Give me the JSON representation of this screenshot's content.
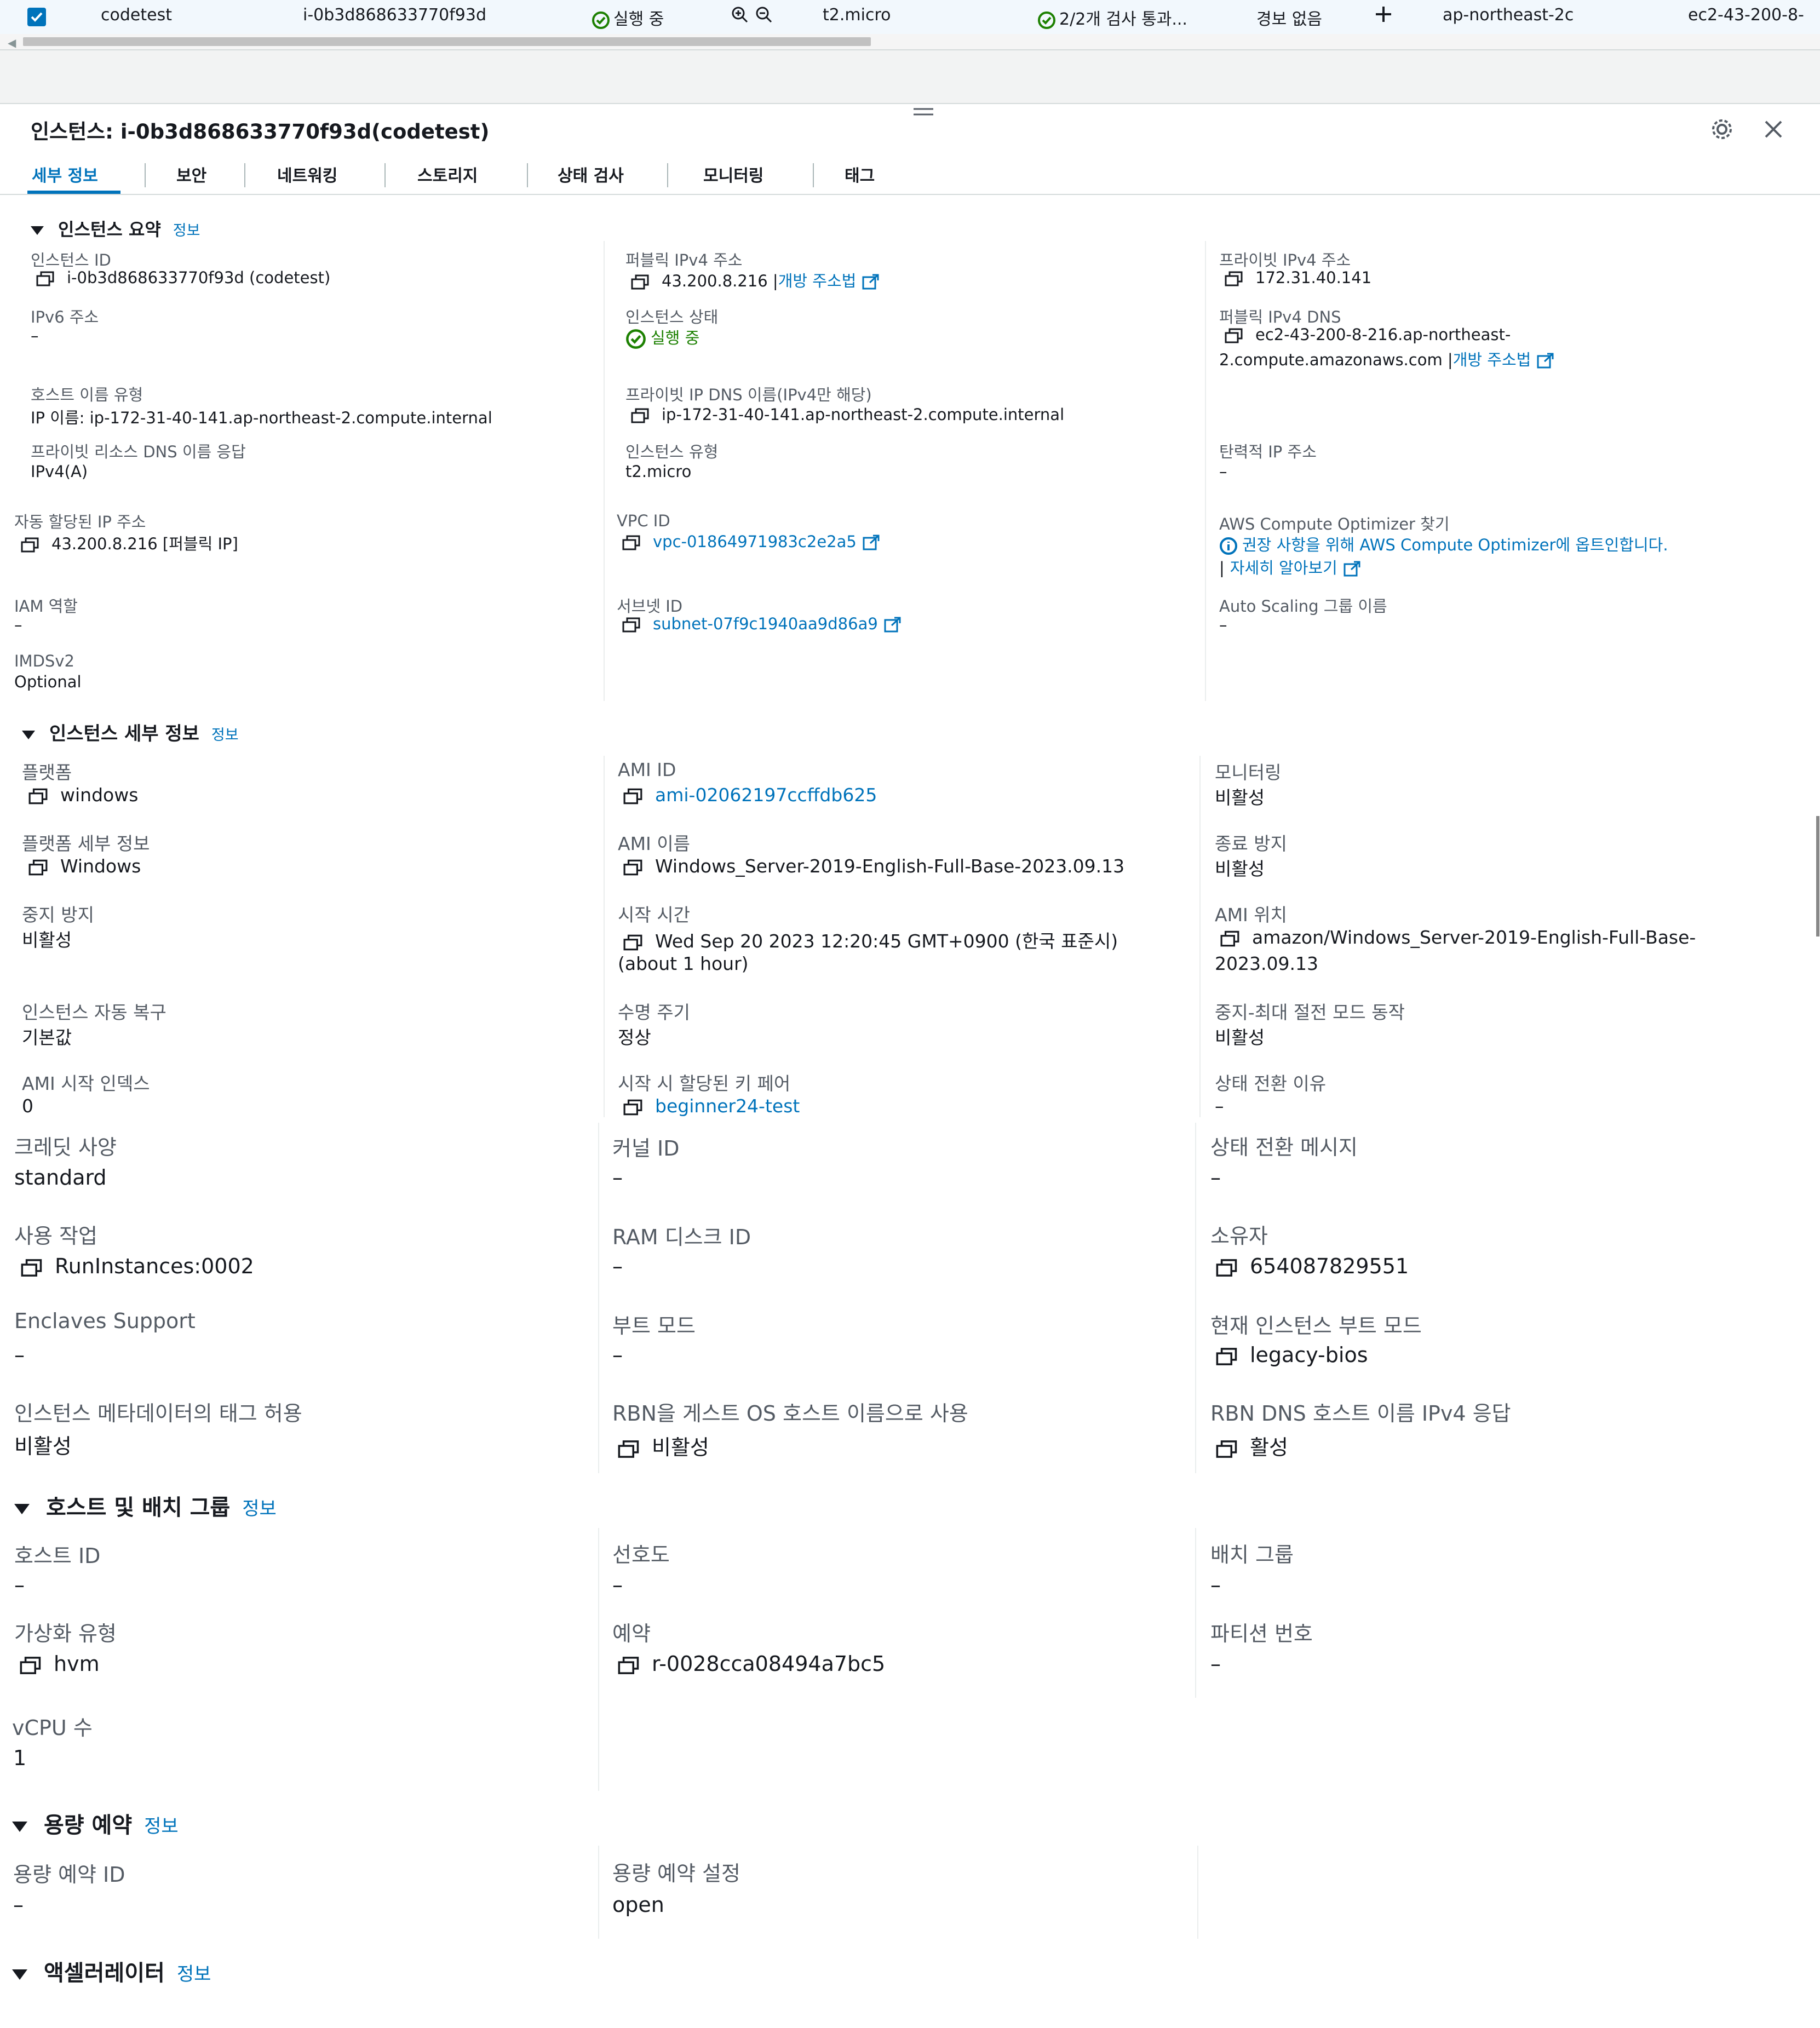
{
  "top_row": {
    "name": "codetest",
    "instance_id": "i-0b3d868633770f93d",
    "state": "실행 중",
    "type": "t2.micro",
    "status_check": "2/2개 검사 통과...",
    "alarm": "경보 없음",
    "add_icon": "plus-icon",
    "az": "ap-northeast-2c",
    "dns_partial": "ec2-43-200-8-"
  },
  "panel": {
    "title": "인스턴스: i-0b3d868633770f93d(codetest)",
    "tabs": [
      "세부 정보",
      "보안",
      "네트워킹",
      "스토리지",
      "상태 검사",
      "모니터링",
      "태그"
    ]
  },
  "summary": {
    "title": "인스턴스 요약",
    "info": "정보",
    "instance_id_label": "인스턴스 ID",
    "instance_id_value": "i-0b3d868633770f93d (codetest)",
    "public_ipv4_label": "퍼블릭 IPv4 주소",
    "public_ipv4_value": "43.200.8.216 |",
    "open_address_link": "개방 주소법",
    "private_ipv4_label": "프라이빗 IPv4 주소",
    "private_ipv4_value": "172.31.40.141",
    "ipv6_label": "IPv6 주소",
    "ipv6_value": "–",
    "state_label": "인스턴스 상태",
    "state_value": "실행 중",
    "public_dns_label": "퍼블릭 IPv4 DNS",
    "public_dns_line1": "ec2-43-200-8-216.ap-northeast-",
    "public_dns_line2": "2.compute.amazonaws.com |",
    "hostname_type_label": "호스트 이름 유형",
    "hostname_type_value": "IP 이름: ip-172-31-40-141.ap-northeast-2.compute.internal",
    "private_dns_label": "프라이빗 IP DNS 이름(IPv4만 해당)",
    "private_dns_value": "ip-172-31-40-141.ap-northeast-2.compute.internal",
    "resource_dns_label": "프라이빗 리소스 DNS 이름 응답",
    "resource_dns_value": "IPv4(A)",
    "instance_type_label": "인스턴스 유형",
    "instance_type_value": "t2.micro",
    "elastic_ip_label": "탄력적 IP 주소",
    "elastic_ip_value": "–",
    "auto_ip_label": "자동 할당된 IP 주소",
    "auto_ip_value": "43.200.8.216 [퍼블릭 IP]",
    "vpc_label": "VPC ID",
    "vpc_value": "vpc-01864971983c2e2a5",
    "optimizer_label": "AWS Compute Optimizer 찾기",
    "optimizer_line1": "권장 사항을 위해 AWS Compute Optimizer에 옵트인합니다.",
    "optimizer_line2": "자세히 알아보기",
    "iam_label": "IAM 역할",
    "iam_value": "–",
    "subnet_label": "서브넷 ID",
    "subnet_value": "subnet-07f9c1940aa9d86a9",
    "asg_label": "Auto Scaling 그룹 이름",
    "asg_value": "–",
    "imds_label": "IMDSv2",
    "imds_value": "Optional"
  },
  "details": {
    "title": "인스턴스 세부 정보",
    "info": "정보",
    "platform_label": "플랫폼",
    "platform_value": "windows",
    "ami_id_label": "AMI ID",
    "ami_id_value": "ami-02062197ccffdb625",
    "monitoring_label": "모니터링",
    "monitoring_value": "비활성",
    "platform_detail_label": "플랫폼 세부 정보",
    "platform_detail_value": "Windows",
    "ami_name_label": "AMI 이름",
    "ami_name_value": "Windows_Server-2019-English-Full-Base-2023.09.13",
    "termination_label": "종료 방지",
    "termination_value": "비활성",
    "stop_protect_label": "중지 방지",
    "stop_protect_value": "비활성",
    "launch_time_label": "시작 시간",
    "launch_time_line1": "Wed Sep 20 2023 12:20:45 GMT+0900 (한국 표준시)",
    "launch_time_line2": "(about 1 hour)",
    "ami_location_label": "AMI 위치",
    "ami_location_line1": "amazon/Windows_Server-2019-English-Full-Base-",
    "ami_location_line2": "2023.09.13",
    "auto_recovery_label": "인스턴스 자동 복구",
    "auto_recovery_value": "기본값",
    "lifecycle_label": "수명 주기",
    "lifecycle_value": "정상",
    "hibernate_label": "중지-최대 절전 모드 동작",
    "hibernate_value": "비활성",
    "ami_launch_index_label": "AMI 시작 인덱스",
    "ami_launch_index_value": "0",
    "key_pair_label": "시작 시 할당된 키 페어",
    "key_pair_value": "beginner24-test",
    "state_reason_label": "상태 전환 이유",
    "state_reason_value": "–",
    "credit_label": "크레딧 사양",
    "credit_value": "standard",
    "kernel_label": "커널 ID",
    "kernel_value": "–",
    "state_msg_label": "상태 전환 메시지",
    "state_msg_value": "–",
    "usage_label": "사용 작업",
    "usage_value": "RunInstances:0002",
    "ramdisk_label": "RAM 디스크 ID",
    "ramdisk_value": "–",
    "owner_label": "소유자",
    "owner_value": "654087829551",
    "enclaves_label": "Enclaves Support",
    "enclaves_value": "–",
    "boot_mode_label": "부트 모드",
    "boot_mode_value": "–",
    "current_boot_label": "현재 인스턴스 부트 모드",
    "current_boot_value": "legacy-bios",
    "meta_tags_label": "인스턴스 메타데이터의 태그 허용",
    "meta_tags_value": "비활성",
    "rbn_label": "RBN을 게스트 OS 호스트 이름으로 사용",
    "rbn_value": "비활성",
    "rbn_dns_label": "RBN DNS 호스트 이름 IPv4 응답",
    "rbn_dns_value": "활성"
  },
  "host": {
    "title": "호스트 및 배치 그룹",
    "info": "정보",
    "host_id_label": "호스트 ID",
    "host_id_value": "–",
    "affinity_label": "선호도",
    "affinity_value": "–",
    "placement_label": "배치 그룹",
    "placement_value": "–",
    "virt_label": "가상화 유형",
    "virt_value": "hvm",
    "reservation_label": "예약",
    "reservation_value": "r-0028cca08494a7bc5",
    "partition_label": "파티션 번호",
    "partition_value": "–",
    "vcpu_label": "vCPU 수",
    "vcpu_value": "1"
  },
  "capacity": {
    "title": "용량 예약",
    "info": "정보",
    "id_label": "용량 예약 ID",
    "id_value": "–",
    "setting_label": "용량 예약 설정",
    "setting_value": "open"
  },
  "accelerator": {
    "title": "액셀러레이터",
    "info": "정보"
  },
  "colors": {
    "link": "#0073bb",
    "success": "#1d8102",
    "text": "#16191f",
    "label": "#545b64",
    "row_highlight": "#f2f8fd"
  }
}
